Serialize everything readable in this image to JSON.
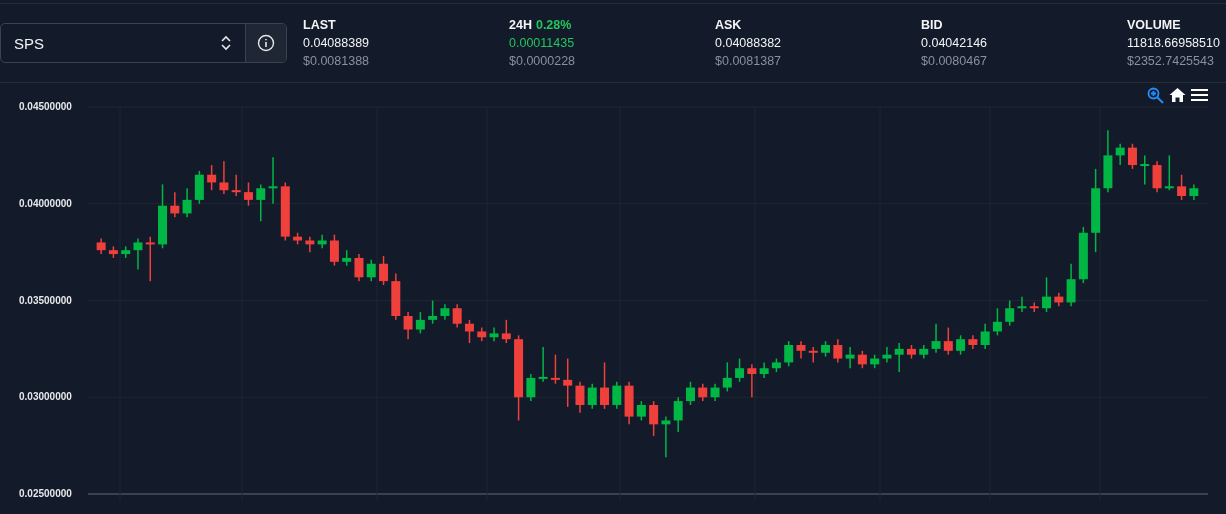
{
  "pair_selector": {
    "value": "SPS"
  },
  "stats": [
    {
      "label": "LAST",
      "kind": "price",
      "value": "0.04088389",
      "usd": "$0.0081388"
    },
    {
      "label": "24H",
      "change": "0.28%",
      "kind": "change",
      "value": "0.00011435",
      "usd": "$0.0000228"
    },
    {
      "label": "ASK",
      "kind": "price",
      "value": "0.04088382",
      "usd": "$0.0081387"
    },
    {
      "label": "BID",
      "kind": "price",
      "value": "0.04042146",
      "usd": "$0.0080467"
    },
    {
      "label": "VOLUME",
      "kind": "price",
      "value": "11818.66958510",
      "usd": "$2352.7425543"
    }
  ],
  "chart_toolbar": [
    {
      "kind": "zoom",
      "selected": true
    },
    {
      "kind": "home",
      "selected": false
    },
    {
      "kind": "menu",
      "selected": false
    }
  ],
  "chart_data": {
    "type": "candlestick",
    "grid": true,
    "ylim": [
      0.025,
      0.045
    ],
    "yticks": [
      {
        "value": 0.045,
        "label": "0.04500000"
      },
      {
        "value": 0.04,
        "label": "0.04000000"
      },
      {
        "value": 0.035,
        "label": "0.03500000"
      },
      {
        "value": 0.03,
        "label": "0.03000000"
      },
      {
        "value": 0.025,
        "label": "0.02500000"
      }
    ],
    "ohlc": [
      [
        0.038,
        0.0382,
        0.0374,
        0.0376
      ],
      [
        0.0376,
        0.0378,
        0.0372,
        0.0374
      ],
      [
        0.0374,
        0.0378,
        0.0372,
        0.0376
      ],
      [
        0.0376,
        0.0382,
        0.0366,
        0.038
      ],
      [
        0.038,
        0.0383,
        0.036,
        0.0379
      ],
      [
        0.0379,
        0.041,
        0.0377,
        0.0399
      ],
      [
        0.0399,
        0.0406,
        0.0393,
        0.0395
      ],
      [
        0.0395,
        0.0408,
        0.0393,
        0.0402
      ],
      [
        0.0402,
        0.0417,
        0.04,
        0.0415
      ],
      [
        0.0415,
        0.042,
        0.0407,
        0.0411
      ],
      [
        0.0411,
        0.0422,
        0.0405,
        0.0407
      ],
      [
        0.0407,
        0.0415,
        0.0404,
        0.0406
      ],
      [
        0.0406,
        0.0411,
        0.0399,
        0.0402
      ],
      [
        0.0402,
        0.041,
        0.0391,
        0.0408
      ],
      [
        0.0408,
        0.0424,
        0.04,
        0.0409
      ],
      [
        0.0409,
        0.0411,
        0.0381,
        0.0383
      ],
      [
        0.0383,
        0.0385,
        0.0379,
        0.0381
      ],
      [
        0.0381,
        0.0383,
        0.0375,
        0.0379
      ],
      [
        0.0379,
        0.0384,
        0.0377,
        0.0381
      ],
      [
        0.0381,
        0.0384,
        0.0368,
        0.037
      ],
      [
        0.037,
        0.0376,
        0.0368,
        0.0372
      ],
      [
        0.0372,
        0.0374,
        0.036,
        0.0362
      ],
      [
        0.0362,
        0.0371,
        0.036,
        0.0369
      ],
      [
        0.0369,
        0.0373,
        0.0358,
        0.036
      ],
      [
        0.036,
        0.0364,
        0.034,
        0.0342
      ],
      [
        0.0342,
        0.0344,
        0.033,
        0.0335
      ],
      [
        0.0335,
        0.0344,
        0.0333,
        0.034
      ],
      [
        0.034,
        0.035,
        0.0338,
        0.0342
      ],
      [
        0.0342,
        0.0348,
        0.034,
        0.0346
      ],
      [
        0.0346,
        0.0348,
        0.0336,
        0.0338
      ],
      [
        0.0338,
        0.034,
        0.0328,
        0.0334
      ],
      [
        0.0334,
        0.0336,
        0.0329,
        0.0331
      ],
      [
        0.0331,
        0.0336,
        0.0329,
        0.0333
      ],
      [
        0.0333,
        0.034,
        0.0328,
        0.033
      ],
      [
        0.033,
        0.0332,
        0.0288,
        0.03
      ],
      [
        0.03,
        0.0312,
        0.0298,
        0.031
      ],
      [
        0.031,
        0.0326,
        0.0308,
        0.031
      ],
      [
        0.031,
        0.0322,
        0.0307,
        0.0309
      ],
      [
        0.0309,
        0.032,
        0.0295,
        0.0306
      ],
      [
        0.0306,
        0.0308,
        0.0292,
        0.0296
      ],
      [
        0.0296,
        0.0307,
        0.0294,
        0.0305
      ],
      [
        0.0305,
        0.0318,
        0.0294,
        0.0296
      ],
      [
        0.0296,
        0.0308,
        0.0294,
        0.0306
      ],
      [
        0.0306,
        0.0308,
        0.0286,
        0.029
      ],
      [
        0.029,
        0.0298,
        0.0288,
        0.0296
      ],
      [
        0.0296,
        0.0298,
        0.028,
        0.0286
      ],
      [
        0.0286,
        0.029,
        0.0269,
        0.0288
      ],
      [
        0.0288,
        0.03,
        0.0282,
        0.0298
      ],
      [
        0.0298,
        0.0308,
        0.0296,
        0.0305
      ],
      [
        0.0305,
        0.0307,
        0.0298,
        0.03
      ],
      [
        0.03,
        0.0307,
        0.0298,
        0.0305
      ],
      [
        0.0305,
        0.0318,
        0.0303,
        0.031
      ],
      [
        0.031,
        0.032,
        0.0308,
        0.0315
      ],
      [
        0.0315,
        0.0317,
        0.03,
        0.0312
      ],
      [
        0.0312,
        0.0318,
        0.031,
        0.0315
      ],
      [
        0.0315,
        0.032,
        0.0313,
        0.0318
      ],
      [
        0.0318,
        0.0329,
        0.0316,
        0.0327
      ],
      [
        0.0327,
        0.0329,
        0.032,
        0.0324
      ],
      [
        0.0324,
        0.0326,
        0.0318,
        0.0323
      ],
      [
        0.0323,
        0.0329,
        0.0321,
        0.0327
      ],
      [
        0.0327,
        0.033,
        0.0318,
        0.032
      ],
      [
        0.032,
        0.0326,
        0.0315,
        0.0322
      ],
      [
        0.0322,
        0.0324,
        0.0315,
        0.0317
      ],
      [
        0.0317,
        0.0322,
        0.0315,
        0.032
      ],
      [
        0.032,
        0.0326,
        0.0318,
        0.0322
      ],
      [
        0.0322,
        0.0328,
        0.0313,
        0.0325
      ],
      [
        0.0325,
        0.0327,
        0.032,
        0.0322
      ],
      [
        0.0322,
        0.0327,
        0.032,
        0.0325
      ],
      [
        0.0325,
        0.0338,
        0.0323,
        0.0329
      ],
      [
        0.0329,
        0.0336,
        0.0322,
        0.0324
      ],
      [
        0.0324,
        0.0332,
        0.0322,
        0.033
      ],
      [
        0.033,
        0.0332,
        0.0325,
        0.0327
      ],
      [
        0.0327,
        0.0338,
        0.0325,
        0.0334
      ],
      [
        0.0334,
        0.0346,
        0.0332,
        0.0339
      ],
      [
        0.0339,
        0.035,
        0.0337,
        0.0346
      ],
      [
        0.0346,
        0.0352,
        0.0344,
        0.0347
      ],
      [
        0.0347,
        0.0349,
        0.0344,
        0.0346
      ],
      [
        0.0346,
        0.0362,
        0.0344,
        0.0352
      ],
      [
        0.0352,
        0.0354,
        0.0347,
        0.0349
      ],
      [
        0.0349,
        0.0369,
        0.0347,
        0.0361
      ],
      [
        0.0361,
        0.0388,
        0.0359,
        0.0385
      ],
      [
        0.0385,
        0.0418,
        0.0375,
        0.0408
      ],
      [
        0.0408,
        0.0438,
        0.0406,
        0.0425
      ],
      [
        0.0425,
        0.0431,
        0.042,
        0.0429
      ],
      [
        0.0429,
        0.0431,
        0.0418,
        0.042
      ],
      [
        0.042,
        0.0425,
        0.041,
        0.042
      ],
      [
        0.042,
        0.0422,
        0.0406,
        0.0408
      ],
      [
        0.0408,
        0.0425,
        0.0407,
        0.0409
      ],
      [
        0.0409,
        0.0415,
        0.0402,
        0.0404
      ],
      [
        0.0404,
        0.041,
        0.0402,
        0.0408
      ]
    ]
  }
}
